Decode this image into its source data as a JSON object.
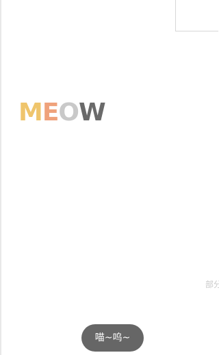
{
  "app": {
    "logo_letters": [
      {
        "char": "M",
        "color": "#efc56c"
      },
      {
        "char": "E",
        "color": "#efa27b"
      },
      {
        "char": "O",
        "color": "#c9c9c9"
      },
      {
        "char": "W",
        "color": "#6a6a6a"
      }
    ],
    "edge_text": "部分",
    "toast_text": "喵~呜~"
  }
}
